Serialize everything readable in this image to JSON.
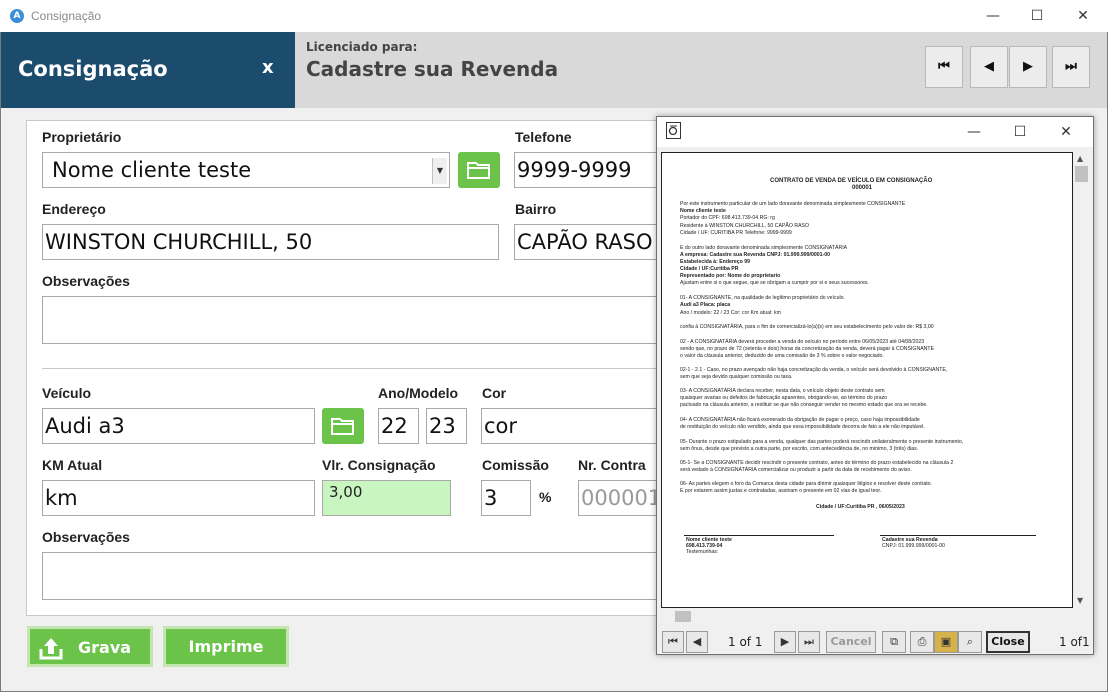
{
  "window": {
    "title": "Consignação",
    "minimize": "—",
    "maximize": "☐",
    "close": "✕"
  },
  "header": {
    "title": "Consignação",
    "close_label": "x",
    "licensed_label": "Licenciado para:",
    "licensed_value": "Cadastre sua Revenda",
    "nav": [
      "⏮",
      "◀",
      "▶",
      "⏭"
    ]
  },
  "form": {
    "owner_label": "Proprietário",
    "owner_value": "Nome cliente teste",
    "phone_label": "Telefone",
    "phone_value": "9999-9999",
    "address_label": "Endereço",
    "address_value": "WINSTON CHURCHILL, 50",
    "district_label": "Bairro",
    "district_value": "CAPÃO RASO",
    "notes1_label": "Observações",
    "vehicle_label": "Veículo",
    "vehicle_value": "Audi a3",
    "year_label": "Ano/Modelo",
    "year_value": "22",
    "model_value": "23",
    "color_label": "Cor",
    "color_value": "cor",
    "km_label": "KM Atual",
    "km_value": "km",
    "consign_label": "Vlr. Consignação",
    "consign_value": "3,00",
    "commission_label": "Comissão",
    "commission_value": "3",
    "percent": "%",
    "contract_label": "Nr. Contra",
    "contract_value": "000001",
    "notes2_label": "Observações"
  },
  "buttons": {
    "save": "Grava",
    "print": "Imprime"
  },
  "viewer": {
    "minimize": "—",
    "maximize": "☐",
    "close": "✕",
    "page_info": "1 of 1",
    "cancel": "Cancel",
    "close_btn": "Close",
    "total": "1 of1",
    "doc": {
      "title": "CONTRATO DE VENDA DE VEÍCULO EM CONSIGNAÇÃO",
      "number": "000001",
      "lines": [
        "Por este instrumento particular de um lado doravante denominada simplesmente CONSIGNANTE",
        "Nome cliente teste",
        "Portador do CPF:     698.413.739-04                              RG:     rg",
        "Residente à      WINSTON CHURCHILL, 50                                                  CAPÃO RASO",
        "Cidade / UF:    CURITIBA                                PR      Telefone:       9999-9999",
        "E do outro lado doravante denominada simplesmente CONSIGNATÁRIA",
        "A empresa:     Cadastre sua Revenda                                              CNPJ: 01.999.999/0001-00",
        "Estabelecida à: Endereço  99",
        "Cidade / UF:Curitiba  PR",
        "Representado por: Nome do proprietario",
        "Ajustam entre si o que segue, que se obrigam a cumprir por si e seus sucessores.",
        "01-  A CONSIGNANTE, na qualidade de legítimo proprietário do veículo.",
        "Audi a3                                                                          Placa:   placa",
        "Ano / modelo:   22     /    23          Cor:      cor                           Km atual:   km",
        "confia à CONSIGNATÁRIA, para o fim de comercializá-lo(a)(s) em seu estabelecimento pelo valor de: R$ 3,00",
        "02 - A CONSIGNATÁRIA deverá proceder a venda do veículo no período entre  06/05/2023        até     04/08/2023",
        "sendo que, no prazo de 72 (setenta e dois) horas da concretização da venda, deverá pagar à CONSIGNANTE",
        "o valor da cláusula anterior, deduzido de uma comissão de 3              % sobre  o valor negociado.",
        "02-1 - 2.1 - Caso, no prazo avençado não haja concretização da venda, o veículo será devolvido à CONSIGNANTE,",
        "sem que seja devido qualquer comissão ou taxa.",
        "03- A CONSIGNATÁRIA declara receber, nesta data, o veículo objeto deste contrato sem",
        "quaisquer avarias ou defeitos de fabricação aparentes, obrigando-se, ao término do prazo",
        "pactuado na cláusula anterior, a restituir se que não conseguir vender no mesmo estado que ora se recebe.",
        "04-  A CONSIGNATÁRIA não ficará exonerado da obrigação de pagar o preço, caso haja impossibilidade",
        "de restituição do veículo não vendido, ainda que essa impossibilidade decorra de fato a ele não imputável.",
        "05- Durante o prazo estipulado para a venda, qualquer das partes poderá rescindir unilateralmente o presente instrumento,",
        "sem ônus, desde que previsto a outra parte, por escrito, com antecedência de, no mínimo, 3 (três) dias.",
        "05-1- Se a CONSIGNANTE decidir rescindir o presente contrato, antes do término do prazo estabelecido na cláusula 2",
        "será vedado à CONSIGNATÁRIA comercializar ou produzir a partir da data de recebimento do aviso.",
        "06- As partes elegem o foro da Comarca desta cidade para dirimir quaisquer litígios e resolver deste contrato.",
        "E por estarem assim justas e contratadas, assinam o presente em 02 vias de igual teor."
      ],
      "place_date": "Cidade / UF:Curitiba  PR , 06/05/2023",
      "sig1_name": "Nome cliente teste",
      "sig1_doc": "698.413.739-04",
      "sig1_role": "Testemunhas:",
      "sig2_name": "Cadastre sua Revenda",
      "sig2_doc": "CNPJ: 01.999.999/0001-00"
    }
  }
}
